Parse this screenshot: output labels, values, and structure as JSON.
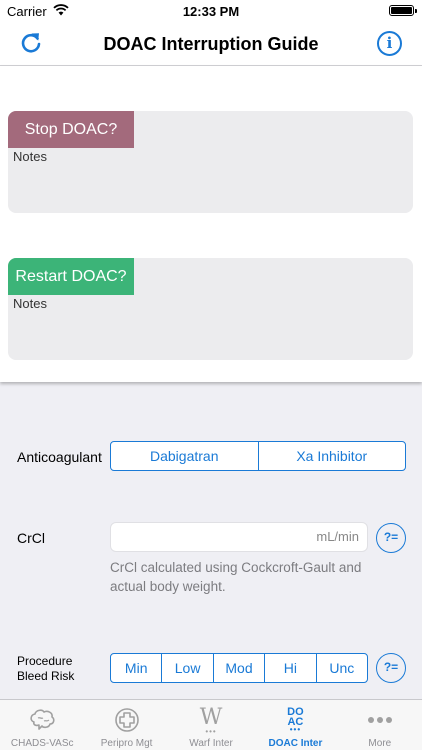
{
  "status_bar": {
    "carrier": "Carrier",
    "time": "12:33 PM"
  },
  "nav": {
    "title": "DOAC Interruption Guide",
    "info_glyph": "i"
  },
  "results": {
    "stop": {
      "tag": "Stop DOAC?",
      "notes": "Notes",
      "color": "#a36a7c"
    },
    "restart": {
      "tag": "Restart DOAC?",
      "notes": "Notes",
      "color": "#3cb478"
    }
  },
  "form": {
    "anticoagulant": {
      "label": "Anticoagulant",
      "options": [
        "Dabigatran",
        "Xa Inhibitor"
      ]
    },
    "crcl": {
      "label": "CrCl",
      "value": "",
      "unit": "mL/min",
      "help": "?=",
      "note": "CrCl calculated using Cockcroft-Gault and actual body weight."
    },
    "bleed_risk": {
      "label_line1": "Procedure",
      "label_line2": "Bleed Risk",
      "options": [
        "Min",
        "Low",
        "Mod",
        "Hi",
        "Unc"
      ],
      "help": "?="
    }
  },
  "tabs": [
    {
      "label": "CHADS-VASc",
      "icon": "brain-icon"
    },
    {
      "label": "Peripro Mgt",
      "icon": "medical-cross-icon"
    },
    {
      "label": "Warf Inter",
      "icon": "warfarin-w-icon",
      "glyph": "W"
    },
    {
      "label": "DOAC Inter",
      "icon": "doac-icon",
      "glyph_top": "DO",
      "glyph_bottom": "AC"
    },
    {
      "label": "More",
      "icon": "more-dots-icon"
    }
  ],
  "colors": {
    "accent": "#1a7ad6",
    "stop": "#a36a7c",
    "restart": "#3cb478"
  }
}
